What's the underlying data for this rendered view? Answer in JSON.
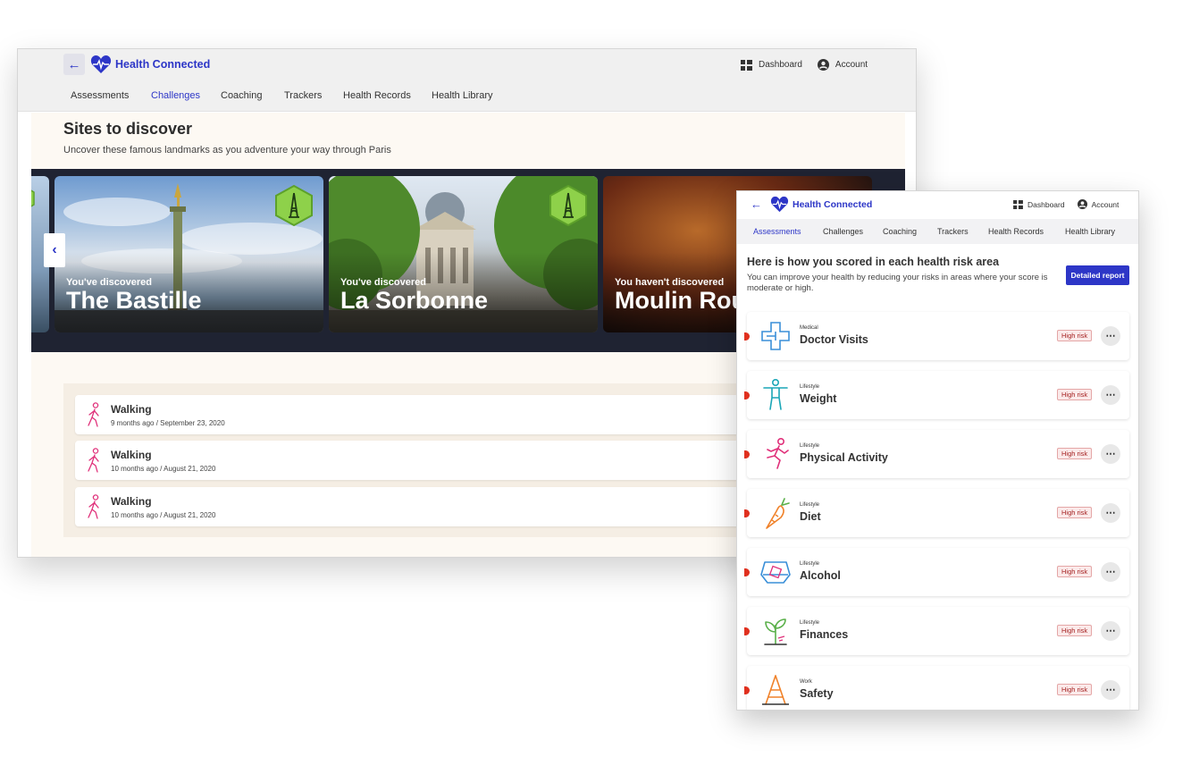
{
  "app": {
    "brand": "Health Connected",
    "accent": "#2d36c7",
    "top_links": {
      "dashboard": "Dashboard",
      "account": "Account"
    },
    "nav": [
      "Assessments",
      "Challenges",
      "Coaching",
      "Trackers",
      "Health Records",
      "Health Library"
    ]
  },
  "challenges_window": {
    "active_tab": "Challenges",
    "title": "Sites to discover",
    "subtitle": "Uncover these famous landmarks as you adventure your way through Paris",
    "sites": [
      {
        "status": "You've discovered",
        "name": "The Bastille",
        "discovered": true
      },
      {
        "status": "You've discovered",
        "name": "La Sorbonne",
        "discovered": true
      },
      {
        "status": "You haven't discovered",
        "name": "Moulin Rou",
        "discovered": false
      }
    ],
    "activities": [
      {
        "type": "Walking",
        "when": "9 months ago / September 23, 2020",
        "icon": "walking-icon"
      },
      {
        "type": "Walking",
        "when": "10 months ago / August 21, 2020",
        "icon": "walking-icon"
      },
      {
        "type": "Walking",
        "when": "10 months ago / August 21, 2020",
        "icon": "walking-icon"
      }
    ]
  },
  "assessments_window": {
    "active_tab": "Assessments",
    "heading": "Here is how you scored in each health risk area",
    "description": "You can improve your health by reducing your risks in areas where your score is moderate or high.",
    "report_button": "Detailed report",
    "risk_areas": [
      {
        "category": "Medical",
        "name": "Doctor Visits",
        "risk": "High risk",
        "icon": "medical-cross-icon",
        "color": "#3a8fd8"
      },
      {
        "category": "Lifestyle",
        "name": "Weight",
        "risk": "High risk",
        "icon": "body-icon",
        "color": "#1aa6b7"
      },
      {
        "category": "Lifestyle",
        "name": "Physical Activity",
        "risk": "High risk",
        "icon": "running-icon",
        "color": "#e0307a"
      },
      {
        "category": "Lifestyle",
        "name": "Diet",
        "risk": "High risk",
        "icon": "carrot-icon",
        "color": "#f0822a"
      },
      {
        "category": "Lifestyle",
        "name": "Alcohol",
        "risk": "High risk",
        "icon": "glass-icon",
        "color": "#3a8fd8"
      },
      {
        "category": "Lifestyle",
        "name": "Finances",
        "risk": "High risk",
        "icon": "sprout-icon",
        "color": "#5ab04a"
      },
      {
        "category": "Work",
        "name": "Safety",
        "risk": "High risk",
        "icon": "ladder-icon",
        "color": "#f0822a"
      }
    ]
  }
}
